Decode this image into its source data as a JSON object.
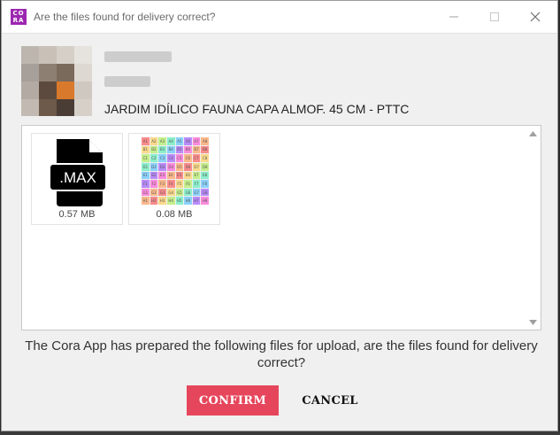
{
  "window": {
    "title": "Are the files found for delivery correct?",
    "logo_top": "CO",
    "logo_bottom": "RA"
  },
  "product": {
    "name": "JARDIM IDÍLICO FAUNA CAPA ALMOF. 45 CM - PTTC"
  },
  "files": [
    {
      "label": ".MAX",
      "size": "0.57 MB",
      "icon": "max-file-icon"
    },
    {
      "label": "",
      "size": "0.08 MB",
      "icon": "uv-grid-texture-thumbnail"
    }
  ],
  "uv_grid": {
    "rows": [
      "A",
      "B",
      "C",
      "D",
      "E",
      "F",
      "G",
      "H"
    ],
    "colors": [
      "#ff6b6b",
      "#ffd36b",
      "#b7f06b",
      "#6bf0c0",
      "#6bc8ff",
      "#a86bff",
      "#ff6bd6",
      "#ffa76b"
    ]
  },
  "prompt": "The Cora App has prepared the following files for upload, are the files found for delivery correct?",
  "buttons": {
    "confirm": "CONFIRM",
    "cancel": "CANCEL"
  },
  "colors": {
    "accent": "#e6465c",
    "logo": "#9c27b0"
  }
}
